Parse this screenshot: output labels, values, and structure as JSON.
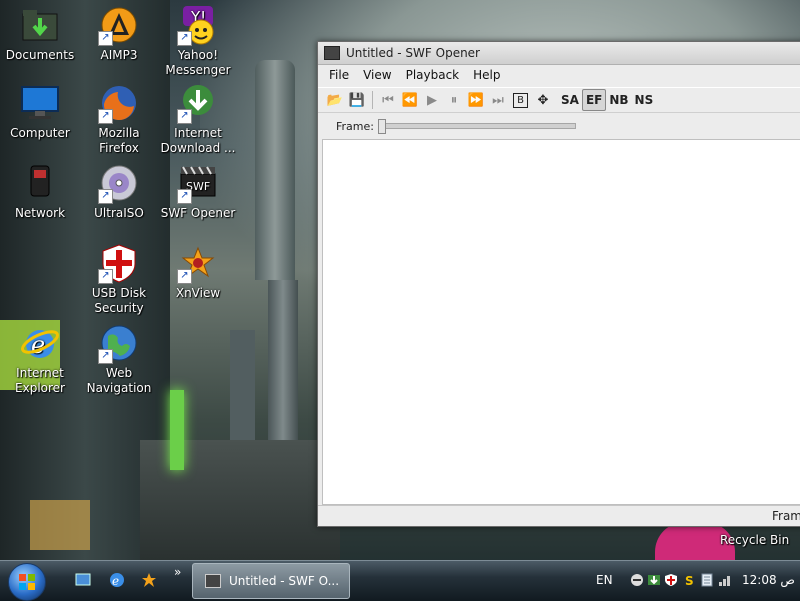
{
  "desktop": {
    "icons": [
      {
        "label": "Documents",
        "glyph": "folder-icon"
      },
      {
        "label": "AIMP3",
        "glyph": "aimp-icon"
      },
      {
        "label": "Yahoo! Messenger",
        "glyph": "yahoo-icon"
      },
      {
        "label": "Computer",
        "glyph": "monitor-icon"
      },
      {
        "label": "Mozilla Firefox",
        "glyph": "firefox-icon"
      },
      {
        "label": "Internet Download ...",
        "glyph": "idm-icon"
      },
      {
        "label": "Network",
        "glyph": "network-icon"
      },
      {
        "label": "UltraISO",
        "glyph": "disc-icon"
      },
      {
        "label": "SWF Opener",
        "glyph": "swf-icon"
      },
      {
        "label": "USB Disk Security",
        "glyph": "shield-icon"
      },
      {
        "label": "XnView",
        "glyph": "xnview-icon"
      },
      {
        "label": "Internet Explorer",
        "glyph": "ie-icon"
      },
      {
        "label": "Web Navigation",
        "glyph": "globe-icon"
      }
    ],
    "recycle_bin": "Recycle Bin"
  },
  "window": {
    "title": "Untitled - SWF Opener",
    "menu": [
      "File",
      "View",
      "Playback",
      "Help"
    ],
    "toolbar": {
      "open": "📂",
      "save": "💾",
      "first": "⏮",
      "rewind": "⏪",
      "play": "▶",
      "pause": "⏸",
      "forward": "⏩",
      "last": "⏭",
      "b": "B",
      "move": "✥",
      "sa": "SA",
      "ef": "EF",
      "nb": "NB",
      "ns": "NS"
    },
    "frame_label": "Frame:",
    "frame_value": 0,
    "status_text": "Fram"
  },
  "taskbar": {
    "task_label": "Untitled - SWF O...",
    "chevron": "»",
    "language": "EN",
    "time": "12:08 ص"
  },
  "colors": {
    "accent": "#2a6cc7",
    "window_bg": "#ececec"
  }
}
